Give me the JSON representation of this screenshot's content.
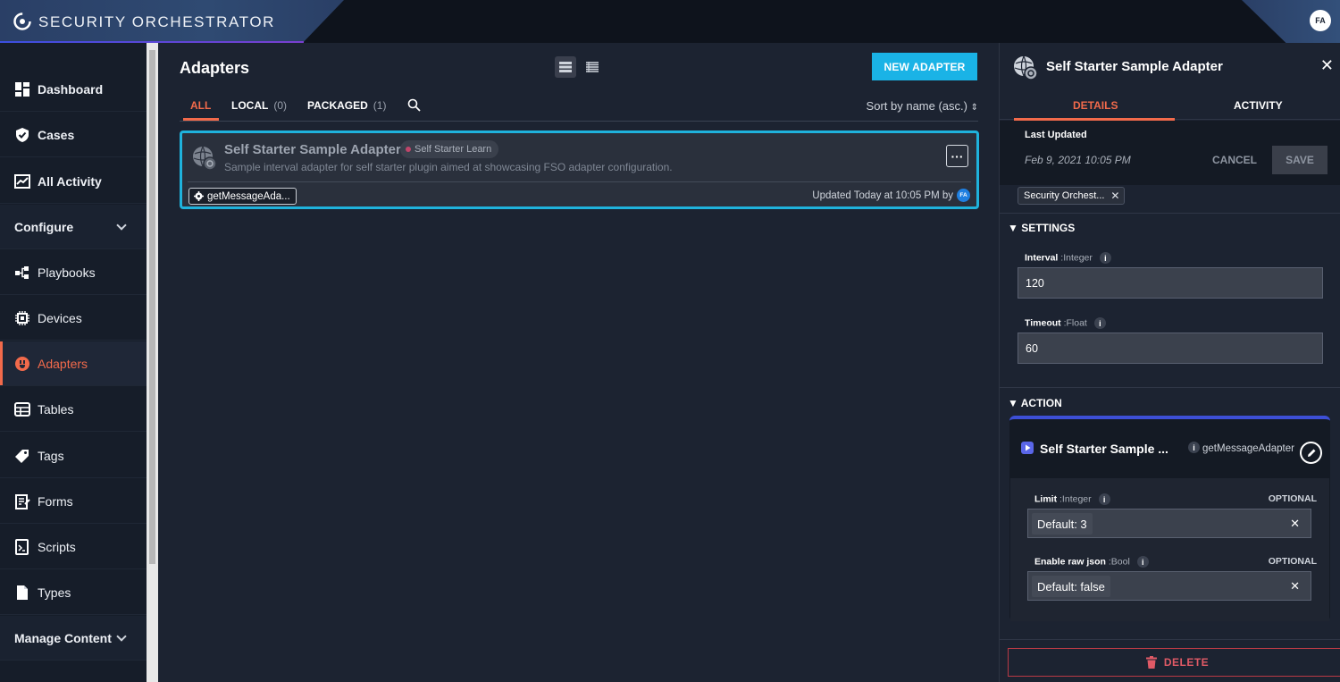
{
  "header": {
    "app_title": "SECURITY ORCHESTRATOR",
    "user_initials": "FA"
  },
  "sidebar": {
    "items": [
      {
        "label": "Dashboard",
        "icon": "dashboard-icon"
      },
      {
        "label": "Cases",
        "icon": "shield-check-icon"
      },
      {
        "label": "All Activity",
        "icon": "activity-chart-icon"
      },
      {
        "label": "Configure",
        "icon": "chevron-down-icon"
      },
      {
        "label": "Playbooks",
        "icon": "playbook-icon"
      },
      {
        "label": "Devices",
        "icon": "chip-icon"
      },
      {
        "label": "Adapters",
        "icon": "adapter-plug-icon"
      },
      {
        "label": "Tables",
        "icon": "table-icon"
      },
      {
        "label": "Tags",
        "icon": "tag-icon"
      },
      {
        "label": "Forms",
        "icon": "form-icon"
      },
      {
        "label": "Scripts",
        "icon": "script-icon"
      },
      {
        "label": "Types",
        "icon": "document-icon"
      },
      {
        "label": "Manage Content",
        "icon": "chevron-down-icon"
      }
    ],
    "active": "Adapters"
  },
  "main": {
    "title": "Adapters",
    "new_button": "NEW ADAPTER",
    "tabs": [
      {
        "label": "ALL",
        "count": ""
      },
      {
        "label": "LOCAL",
        "count": "(0)"
      },
      {
        "label": "PACKAGED",
        "count": "(1)"
      }
    ],
    "sort_label": "Sort by name (asc.)",
    "card": {
      "title": "Self Starter Sample Adapter",
      "tag": "Self Starter Learn",
      "description": "Sample interval adapter for self starter plugin aimed at showcasing FSO adapter configuration.",
      "chip": "getMessageAda...",
      "updated": "Updated Today at 10:05 PM by",
      "avatar": "FA"
    }
  },
  "panel": {
    "title": "Self Starter Sample Adapter",
    "tabs": [
      "DETAILS",
      "ACTIVITY"
    ],
    "last_updated_label": "Last Updated",
    "last_updated_value": "Feb 9, 2021 10:05 PM",
    "cancel": "CANCEL",
    "save": "SAVE",
    "chip": "Security Orchest...",
    "settings_heading": "SETTINGS",
    "settings": [
      {
        "name": "Interval",
        "type": ":Integer",
        "value": "120"
      },
      {
        "name": "Timeout",
        "type": ":Float",
        "value": "60"
      }
    ],
    "action_heading": "ACTION",
    "action": {
      "title": "Self Starter Sample ...",
      "subtitle": "getMessageAdapter",
      "params": [
        {
          "name": "Limit",
          "type": ":Integer",
          "optional": "OPTIONAL",
          "value": "Default: 3"
        },
        {
          "name": "Enable raw json",
          "type": ":Bool",
          "optional": "OPTIONAL",
          "value": "Default: false"
        }
      ]
    },
    "delete": "DELETE"
  },
  "colors": {
    "accent": "#f26a4b",
    "primary": "#1ab3e6",
    "danger": "#e05a66",
    "action_bar": "#3d4fd6"
  }
}
